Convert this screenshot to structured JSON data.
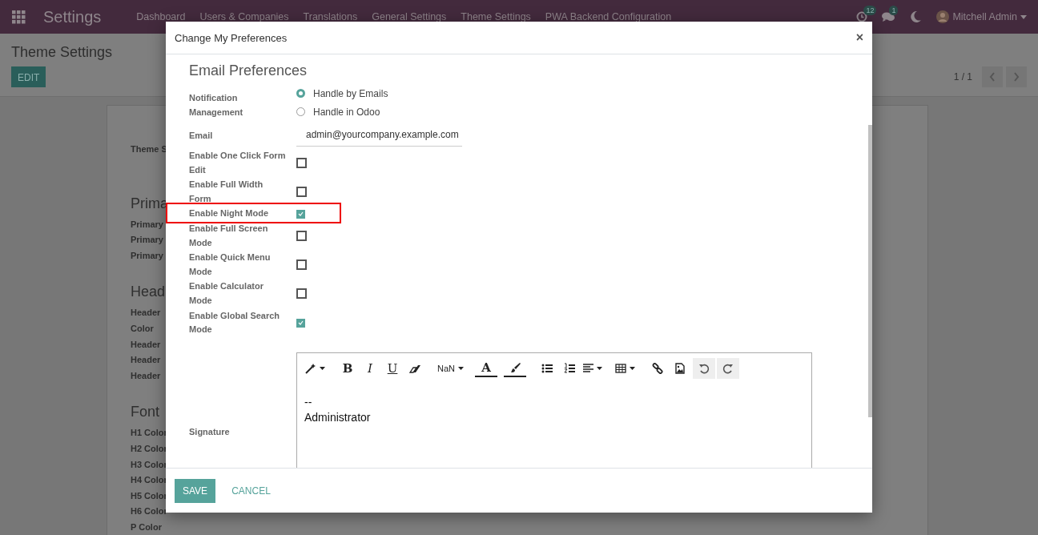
{
  "navbar": {
    "app_title": "Settings",
    "menu": [
      "Dashboard",
      "Users & Companies",
      "Translations",
      "General Settings",
      "Theme Settings",
      "PWA Backend Configuration"
    ],
    "activity_count": "12",
    "message_count": "1",
    "user_name": "Mitchell Admin"
  },
  "control_panel": {
    "title": "Theme Settings",
    "edit_button": "EDIT",
    "pager": "1 / 1"
  },
  "background_labels": [
    {
      "text": "Theme S",
      "kind": "field"
    },
    {
      "text": "Prima",
      "kind": "heading"
    },
    {
      "text": "Primary",
      "kind": "field"
    },
    {
      "text": "Primary",
      "kind": "field"
    },
    {
      "text": "Primary",
      "kind": "field"
    },
    {
      "text": "Head",
      "kind": "heading"
    },
    {
      "text": "Header",
      "kind": "field"
    },
    {
      "text": "Color",
      "kind": "field"
    },
    {
      "text": "Header",
      "kind": "field"
    },
    {
      "text": "Header",
      "kind": "field"
    },
    {
      "text": "Header",
      "kind": "field"
    },
    {
      "text": "Font",
      "kind": "heading"
    },
    {
      "text": "H1 Color",
      "kind": "field"
    },
    {
      "text": "H2 Color",
      "kind": "field"
    },
    {
      "text": "H3 Color",
      "kind": "field"
    },
    {
      "text": "H4 Color",
      "kind": "field"
    },
    {
      "text": "H5 Color",
      "kind": "field"
    },
    {
      "text": "H6 Color",
      "kind": "field"
    },
    {
      "text": "P Color",
      "kind": "field"
    }
  ],
  "dialog": {
    "title": "Change My Preferences",
    "close_label": "×",
    "section_title": "Email Preferences",
    "fields": [
      {
        "kind": "radio",
        "label": "Notification Management",
        "options": [
          {
            "label": "Handle by Emails",
            "selected": true
          },
          {
            "label": "Handle in Odoo",
            "selected": false
          }
        ]
      },
      {
        "kind": "text",
        "label": "Email",
        "value": "admin@yourcompany.example.com"
      },
      {
        "kind": "checkbox",
        "label": "Enable One Click Form Edit",
        "checked": false,
        "highlighted": false
      },
      {
        "kind": "checkbox",
        "label": "Enable Full Width Form",
        "checked": false,
        "highlighted": false
      },
      {
        "kind": "checkbox",
        "label": "Enable Night Mode",
        "checked": true,
        "highlighted": true
      },
      {
        "kind": "checkbox",
        "label": "Enable Full Screen Mode",
        "checked": false,
        "highlighted": false
      },
      {
        "kind": "checkbox",
        "label": "Enable Quick Menu Mode",
        "checked": false,
        "highlighted": false
      },
      {
        "kind": "checkbox",
        "label": "Enable Calculator Mode",
        "checked": false,
        "highlighted": false
      },
      {
        "kind": "checkbox",
        "label": "Enable Global Search Mode",
        "checked": true,
        "highlighted": false
      }
    ],
    "signature": {
      "label": "Signature",
      "toolbar": [
        {
          "kind": "wand"
        },
        {
          "kind": "bold",
          "label": "B"
        },
        {
          "kind": "italic",
          "label": "I"
        },
        {
          "kind": "underline",
          "label": "U"
        },
        {
          "kind": "eraser"
        },
        {
          "kind": "dropdown",
          "label": "NaN"
        },
        {
          "kind": "fontcolor",
          "label": "A"
        },
        {
          "kind": "brush"
        },
        {
          "kind": "ul"
        },
        {
          "kind": "ol"
        },
        {
          "kind": "align"
        },
        {
          "kind": "table"
        },
        {
          "kind": "link"
        },
        {
          "kind": "image"
        },
        {
          "kind": "undo"
        },
        {
          "kind": "redo"
        }
      ],
      "lines": [
        "--",
        "Administrator"
      ]
    },
    "buttons": [
      {
        "kind": "primary",
        "label": "SAVE"
      },
      {
        "kind": "link",
        "label": "CANCEL"
      }
    ]
  }
}
